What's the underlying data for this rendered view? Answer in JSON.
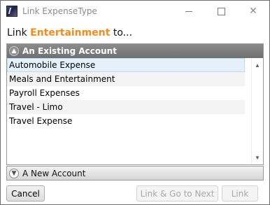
{
  "window": {
    "title": "Link ExpenseType",
    "minimize_glyph": "",
    "maximize_glyph": "",
    "close_glyph": "✕"
  },
  "heading": {
    "prefix": "Link ",
    "entity": "Entertainment",
    "suffix": " to..."
  },
  "existing_section": {
    "label": "An Existing Account",
    "icon": "chevron-up-circle-icon",
    "items": [
      {
        "label": "Automobile Expense",
        "selected": true
      },
      {
        "label": "Meals and Entertainment",
        "selected": false
      },
      {
        "label": "Payroll Expenses",
        "selected": false
      },
      {
        "label": "Travel - Limo",
        "selected": false
      },
      {
        "label": "Travel Expense",
        "selected": false
      }
    ]
  },
  "new_section": {
    "label": "A New Account",
    "icon": "chevron-down-circle-icon"
  },
  "buttons": {
    "cancel": "Cancel",
    "link_go_next": "Link & Go to Next",
    "link": "Link"
  },
  "colors": {
    "accent": "#f28c1e",
    "section_header": "#7d7d7d",
    "selection": "#e4f1fb"
  }
}
